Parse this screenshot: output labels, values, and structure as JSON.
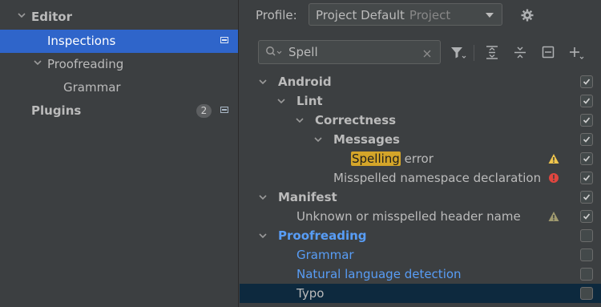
{
  "sidebar": {
    "items": [
      {
        "label": "Editor",
        "bold": true
      },
      {
        "label": "Inspections",
        "selected": true
      },
      {
        "label": "Proofreading"
      },
      {
        "label": "Grammar"
      },
      {
        "label": "Plugins",
        "bold": true,
        "badge": "2"
      }
    ]
  },
  "header": {
    "profile_label": "Profile:",
    "profile_value": "Project Default",
    "profile_scope": "Project"
  },
  "search": {
    "value": "Spell"
  },
  "tree": {
    "rows": [
      {
        "label": "Android",
        "bold": true,
        "checked": true,
        "expanded": true
      },
      {
        "label": "Lint",
        "bold": true,
        "checked": true,
        "expanded": true
      },
      {
        "label": "Correctness",
        "bold": true,
        "checked": true,
        "expanded": true
      },
      {
        "label": "Messages",
        "bold": true,
        "checked": true,
        "expanded": true
      },
      {
        "label_highlight": "Spelling",
        "label_rest": " error",
        "checked": true,
        "severity": "warning"
      },
      {
        "label": "Misspelled namespace declaration",
        "checked": true,
        "severity": "error"
      },
      {
        "label": "Manifest",
        "bold": true,
        "checked": true,
        "expanded": true
      },
      {
        "label": "Unknown or misspelled header name",
        "checked": true,
        "severity": "weak-warning"
      },
      {
        "label": "Proofreading",
        "bold": true,
        "link": true,
        "checked": false,
        "expanded": true
      },
      {
        "label": "Grammar",
        "link": true,
        "checked": false
      },
      {
        "label": "Natural language detection",
        "link": true,
        "checked": false
      },
      {
        "label": "Typo",
        "checked": false,
        "selected": true
      }
    ]
  },
  "colors": {
    "background": "#3c3f41",
    "selection": "#2f65ca",
    "tree_selection": "#0d293e",
    "link": "#589df6",
    "match_highlight": "#d4a529",
    "warning": "#f0c54c",
    "error": "#e0463f",
    "weak_warning": "#a09a6f"
  }
}
